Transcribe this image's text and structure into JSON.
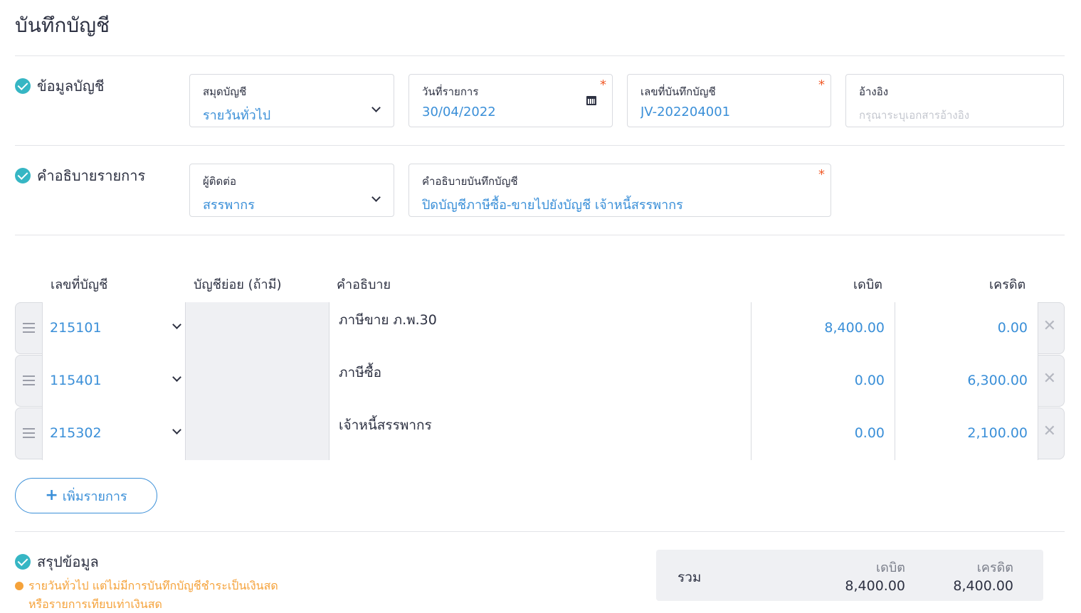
{
  "title": "บันทึกบัญชี",
  "sections": {
    "account_info": "ข้อมูลบัญชี",
    "description": "คำอธิบายรายการ",
    "summary": "สรุปข้อมูล"
  },
  "fields": {
    "journal_book": {
      "label": "สมุดบัญชี",
      "value": "รายวันทั่วไป"
    },
    "transaction_date": {
      "label": "วันที่รายการ",
      "value": "30/04/2022"
    },
    "journal_number": {
      "label": "เลขที่บันทึกบัญชี",
      "value": "JV-202204001"
    },
    "reference": {
      "label": "อ้างอิง",
      "placeholder": "กรุณาระบุเอกสารอ้างอิง"
    },
    "contact": {
      "label": "ผู้ติดต่อ",
      "value": "สรรพากร"
    },
    "journal_description": {
      "label": "คำอธิบายบันทึกบัญชี",
      "value": "ปิดบัญชีภาษีซื้อ-ขายไปยังบัญชี เจ้าหนี้สรรพากร"
    },
    "required_mark": "*"
  },
  "table": {
    "headers": {
      "account_no": "เลขที่บัญชี",
      "sub_account": "บัญชีย่อย (ถ้ามี)",
      "description": "คำอธิบาย",
      "debit": "เดบิต",
      "credit": "เครดิต"
    },
    "rows": [
      {
        "account": "215101",
        "description": "ภาษีขาย ภ.พ.30",
        "debit": "8,400.00",
        "credit": "0.00"
      },
      {
        "account": "115401",
        "description": "ภาษีซื้อ",
        "debit": "0.00",
        "credit": "6,300.00"
      },
      {
        "account": "215302",
        "description": "เจ้าหนี้สรรพากร",
        "debit": "0.00",
        "credit": "2,100.00"
      }
    ],
    "remove_glyph": "✕"
  },
  "add_button": {
    "plus": "+",
    "label": "เพิ่มรายการ"
  },
  "warning": {
    "line1": "รายวันทั่วไป แต่ไม่มีการบันทึกบัญชีชำระเป็นเงินสด",
    "line2": "หรือรายการเทียบเท่าเงินสด"
  },
  "summary": {
    "total_label": "รวม",
    "debit_label": "เดบิต",
    "credit_label": "เครดิต",
    "debit_total": "8,400.00",
    "credit_total": "8,400.00"
  },
  "colors": {
    "accent": "#3a8fd8",
    "check": "#36b6c4",
    "required": "#f05a28",
    "warning": "#f5a23a"
  },
  "icons": {
    "check": "check-circle-icon",
    "chevron": "chevron-down-icon",
    "calendar": "calendar-icon",
    "drag": "drag-handle-icon",
    "remove": "close-icon",
    "add": "plus-icon"
  }
}
